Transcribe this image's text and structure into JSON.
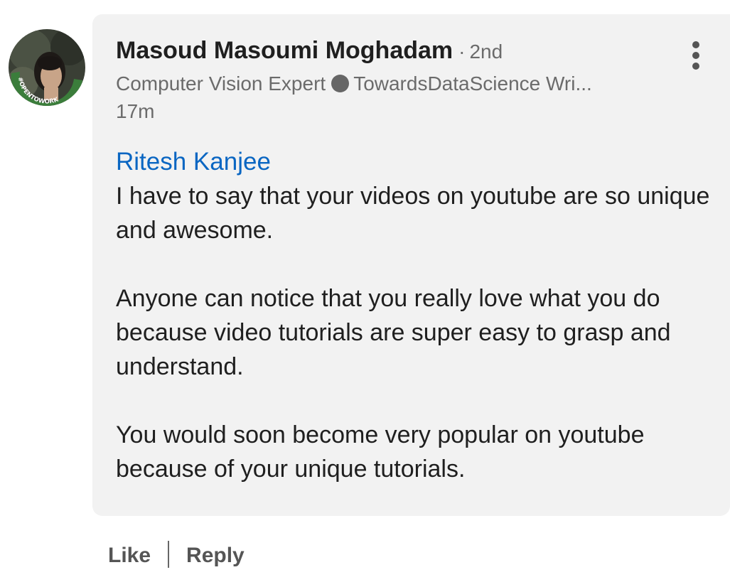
{
  "comment": {
    "author": {
      "name": "Masoud Masoumi Moghadam",
      "separator": "·",
      "degree": "2nd",
      "headline_part1": "Computer Vision Expert",
      "headline_part2": "TowardsDataScience Wri...",
      "timestamp": "17m",
      "avatar_badge_text": "#OPENTOWORK"
    },
    "mention": "Ritesh Kanjee",
    "paragraphs": [
      "I have to say that your videos on youtube are so unique and awesome.",
      "Anyone can notice that you really love what you do because video tutorials are super easy to grasp and understand.",
      "You would soon become very popular on youtube because of your unique tutorials."
    ],
    "menu_icon": "more-vertical-icon"
  },
  "actions": {
    "like_label": "Like",
    "divider": "|",
    "reply_label": "Reply"
  },
  "colors": {
    "bubble_background": "#f2f2f2",
    "mention_link": "#0a66c2",
    "open_to_work_badge": "#3b7d3b",
    "secondary_text": "#6b6b6b"
  }
}
